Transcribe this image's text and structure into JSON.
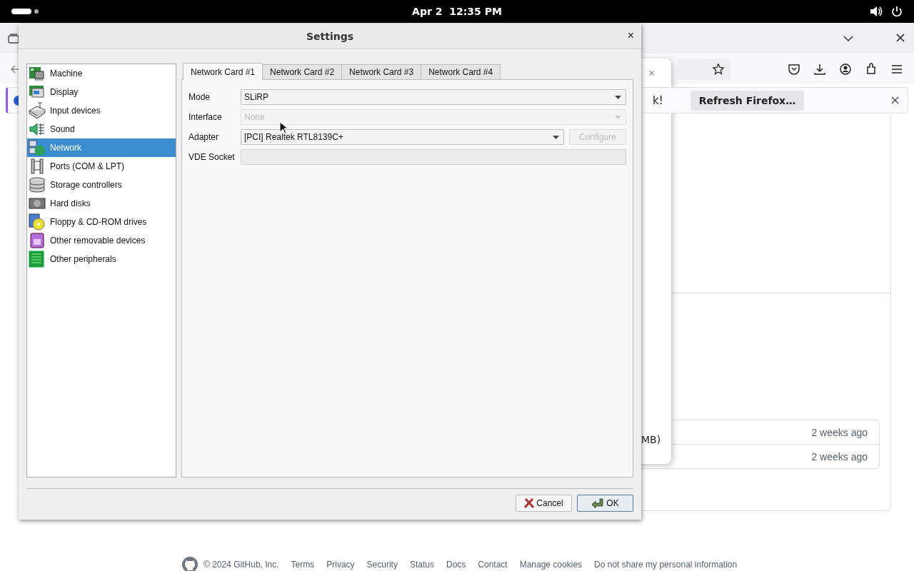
{
  "system_bar": {
    "clock": "Apr 2  12:35 PM"
  },
  "browser": {
    "notification": {
      "text": "k!",
      "button": "Refresh Firefox…"
    },
    "popup": {
      "close": "×",
      "text": "MB)"
    },
    "list_rows": [
      {
        "time": "2 weeks ago"
      },
      {
        "time": "2 weeks ago"
      }
    ],
    "footer": {
      "copyright": "© 2024 GitHub, Inc.",
      "links": [
        "Terms",
        "Privacy",
        "Security",
        "Status",
        "Docs",
        "Contact",
        "Manage cookies",
        "Do not share my personal information"
      ]
    }
  },
  "dialog": {
    "title": "Settings",
    "close": "×",
    "categories": [
      {
        "label": "Machine",
        "selected": false
      },
      {
        "label": "Display",
        "selected": false
      },
      {
        "label": "Input devices",
        "selected": false
      },
      {
        "label": "Sound",
        "selected": false
      },
      {
        "label": "Network",
        "selected": true
      },
      {
        "label": "Ports (COM & LPT)",
        "selected": false
      },
      {
        "label": "Storage controllers",
        "selected": false
      },
      {
        "label": "Hard disks",
        "selected": false
      },
      {
        "label": "Floppy & CD-ROM drives",
        "selected": false
      },
      {
        "label": "Other removable devices",
        "selected": false
      },
      {
        "label": "Other peripherals",
        "selected": false
      }
    ],
    "tabs": [
      {
        "label": "Network Card #1",
        "selected": true
      },
      {
        "label": "Network Card #2",
        "selected": false
      },
      {
        "label": "Network Card #3",
        "selected": false
      },
      {
        "label": "Network Card #4",
        "selected": false
      }
    ],
    "fields": [
      {
        "label": "Mode",
        "kind": "select",
        "value": "SLiRP",
        "disabled": false
      },
      {
        "label": "Interface",
        "kind": "select",
        "value": "None",
        "disabled": true
      },
      {
        "label": "Adapter",
        "kind": "select",
        "value": "[PCI] Realtek RTL8139C+",
        "disabled": false,
        "button": {
          "label": "Configure",
          "disabled": true
        }
      },
      {
        "label": "VDE Socket",
        "kind": "text",
        "disabled": true
      }
    ],
    "buttons": [
      {
        "label": "Cancel",
        "kind": "cancel",
        "default": false
      },
      {
        "label": "OK",
        "kind": "ok",
        "default": true
      }
    ]
  }
}
